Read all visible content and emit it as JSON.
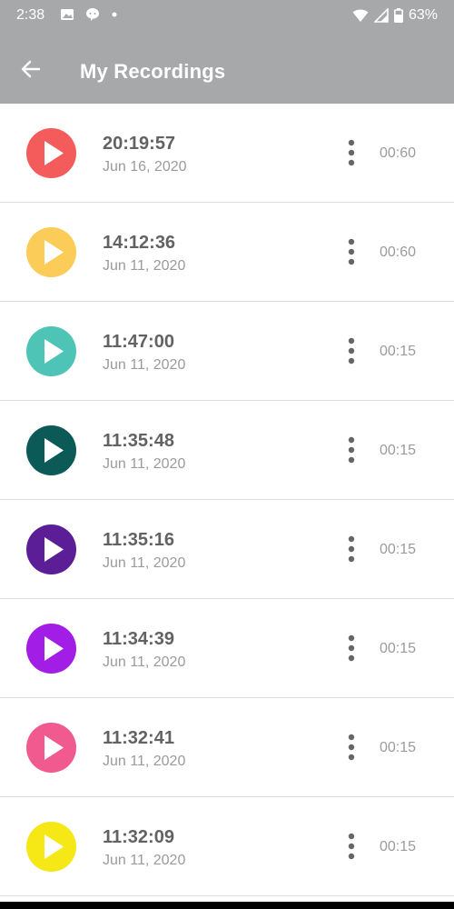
{
  "status_bar": {
    "time": "2:38",
    "battery": "63%",
    "icons": [
      "image-icon",
      "chat-bubble-icon",
      "dot-icon",
      "wifi-icon",
      "signal-icon",
      "battery-icon"
    ]
  },
  "app_bar": {
    "title": "My Recordings",
    "back_icon": "arrow-back-icon",
    "background": "#a6a8aa"
  },
  "recordings": [
    {
      "time": "20:19:57",
      "date": "Jun 16, 2020",
      "duration": "00:60",
      "color": "#f45b5b"
    },
    {
      "time": "14:12:36",
      "date": "Jun 11, 2020",
      "duration": "00:60",
      "color": "#fbcc57"
    },
    {
      "time": "11:47:00",
      "date": "Jun 11, 2020",
      "duration": "00:15",
      "color": "#4ec4b6"
    },
    {
      "time": "11:35:48",
      "date": "Jun 11, 2020",
      "duration": "00:15",
      "color": "#0b5a57"
    },
    {
      "time": "11:35:16",
      "date": "Jun 11, 2020",
      "duration": "00:15",
      "color": "#5b1e96"
    },
    {
      "time": "11:34:39",
      "date": "Jun 11, 2020",
      "duration": "00:15",
      "color": "#a21ee6"
    },
    {
      "time": "11:32:41",
      "date": "Jun 11, 2020",
      "duration": "00:15",
      "color": "#f05a8f"
    },
    {
      "time": "11:32:09",
      "date": "Jun 11, 2020",
      "duration": "00:15",
      "color": "#f6e716"
    }
  ]
}
